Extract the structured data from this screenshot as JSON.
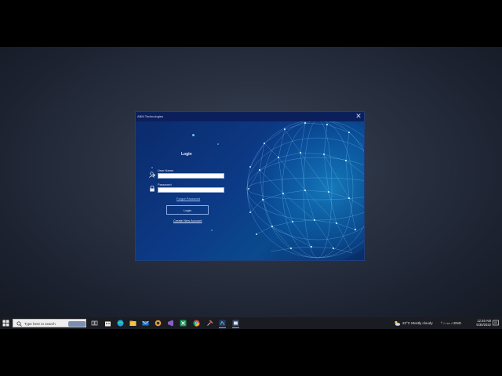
{
  "window": {
    "title": "ABM Technologies",
    "close_label": "✕"
  },
  "login": {
    "heading": "Login",
    "username_label": "User Name",
    "username_value": "",
    "password_label": "Password",
    "password_value": "",
    "forgot_link": "Forgot Password",
    "login_button": "Login",
    "create_link": "Create New Account"
  },
  "taskbar": {
    "search_placeholder": "Type here to search",
    "apps": [
      "task-view",
      "explorer",
      "edge",
      "file-explorer",
      "mail",
      "chrome-like",
      "visual-studio",
      "excel",
      "chrome",
      "tool",
      "app-active-1",
      "app-active-2"
    ]
  },
  "tray": {
    "weather": "22°C  Mostly cloudy",
    "tray_icons": "^  ⌂  ▭  ♪  ENG",
    "time": "12:46 AM",
    "date": "5/30/2022"
  },
  "colors": {
    "window_bg": "#0c3a86",
    "titlebar": "#0b1f5c",
    "taskbar": "#1a1c22",
    "accent": "#6ec2ff"
  }
}
